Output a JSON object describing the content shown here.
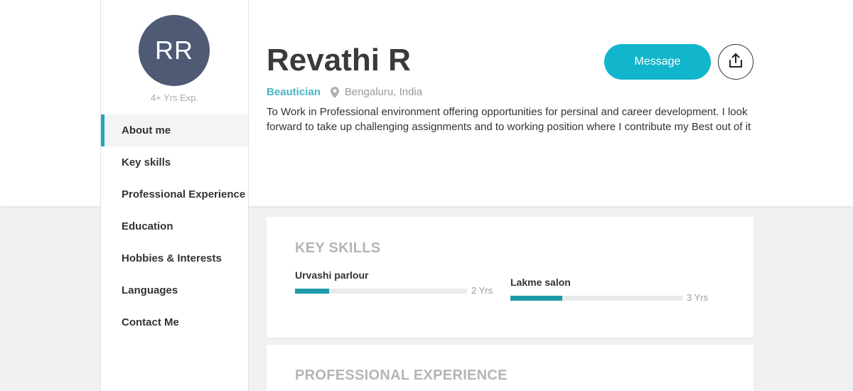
{
  "profile": {
    "initials": "RR",
    "experience": "4+ Yrs Exp.",
    "name": "Revathi R",
    "role": "Beautician",
    "location": "Bengaluru, India",
    "summary": "To Work in Professional environment offering opportunities for persinal and career development. I look forward to take up challenging assignments and to working position where I contribute my Best out of it"
  },
  "actions": {
    "message_label": "Message",
    "share_icon": "share-icon"
  },
  "nav": {
    "items": [
      {
        "label": "About me",
        "active": true
      },
      {
        "label": "Key skills",
        "active": false
      },
      {
        "label": "Professional Experience",
        "active": false
      },
      {
        "label": "Education",
        "active": false
      },
      {
        "label": "Hobbies & Interests",
        "active": false
      },
      {
        "label": "Languages",
        "active": false
      },
      {
        "label": "Contact Me",
        "active": false
      }
    ]
  },
  "key_skills": {
    "title": "KEY SKILLS",
    "skills": [
      {
        "name": "Urvashi parlour",
        "years": "2 Yrs",
        "level": 0.2
      },
      {
        "name": "Lakme salon",
        "years": "3 Yrs",
        "level": 0.3
      }
    ]
  },
  "professional_experience": {
    "title": "PROFESSIONAL EXPERIENCE"
  },
  "colors": {
    "accent": "#12b6cc",
    "avatar_bg": "#4f5a75",
    "role_text": "#4bb3c4",
    "skill_bar": "#1d9aa8"
  }
}
